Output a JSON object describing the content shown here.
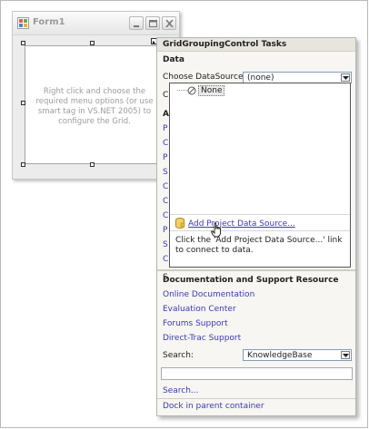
{
  "form": {
    "title": "Form1",
    "design_hint": "Right click and choose the required menu options (or use smart tag in VS.NET 2005) to configure the Grid."
  },
  "tasks": {
    "header": "GridGroupingControl Tasks",
    "data_section": "Data",
    "choose_datasource_label": "Choose DataSource",
    "datasource_value": "(none)",
    "clipped_letters": [
      "C",
      "A",
      "P",
      "C",
      "P",
      "S",
      "C",
      "C",
      "C",
      "P",
      "S",
      "C",
      "S"
    ],
    "docs_section": "Documentation and Support Resource",
    "links": [
      "Online Documentation",
      "Evaluation Center",
      "Forums Support",
      "Direct-Trac Support"
    ],
    "search_label": "Search:",
    "search_value": "KnowledgeBase",
    "search_link": "Search...",
    "dock_link": "Dock in parent container"
  },
  "dropdown": {
    "tree_item": "None",
    "add_link": "Add Project Data Source...",
    "help_text": "Click the 'Add Project Data Source...' link to connect to data."
  },
  "colors": {
    "link": "#3a3ab4",
    "panel_bg": "#f7f6f2",
    "header_bg": "#e7e5de"
  }
}
